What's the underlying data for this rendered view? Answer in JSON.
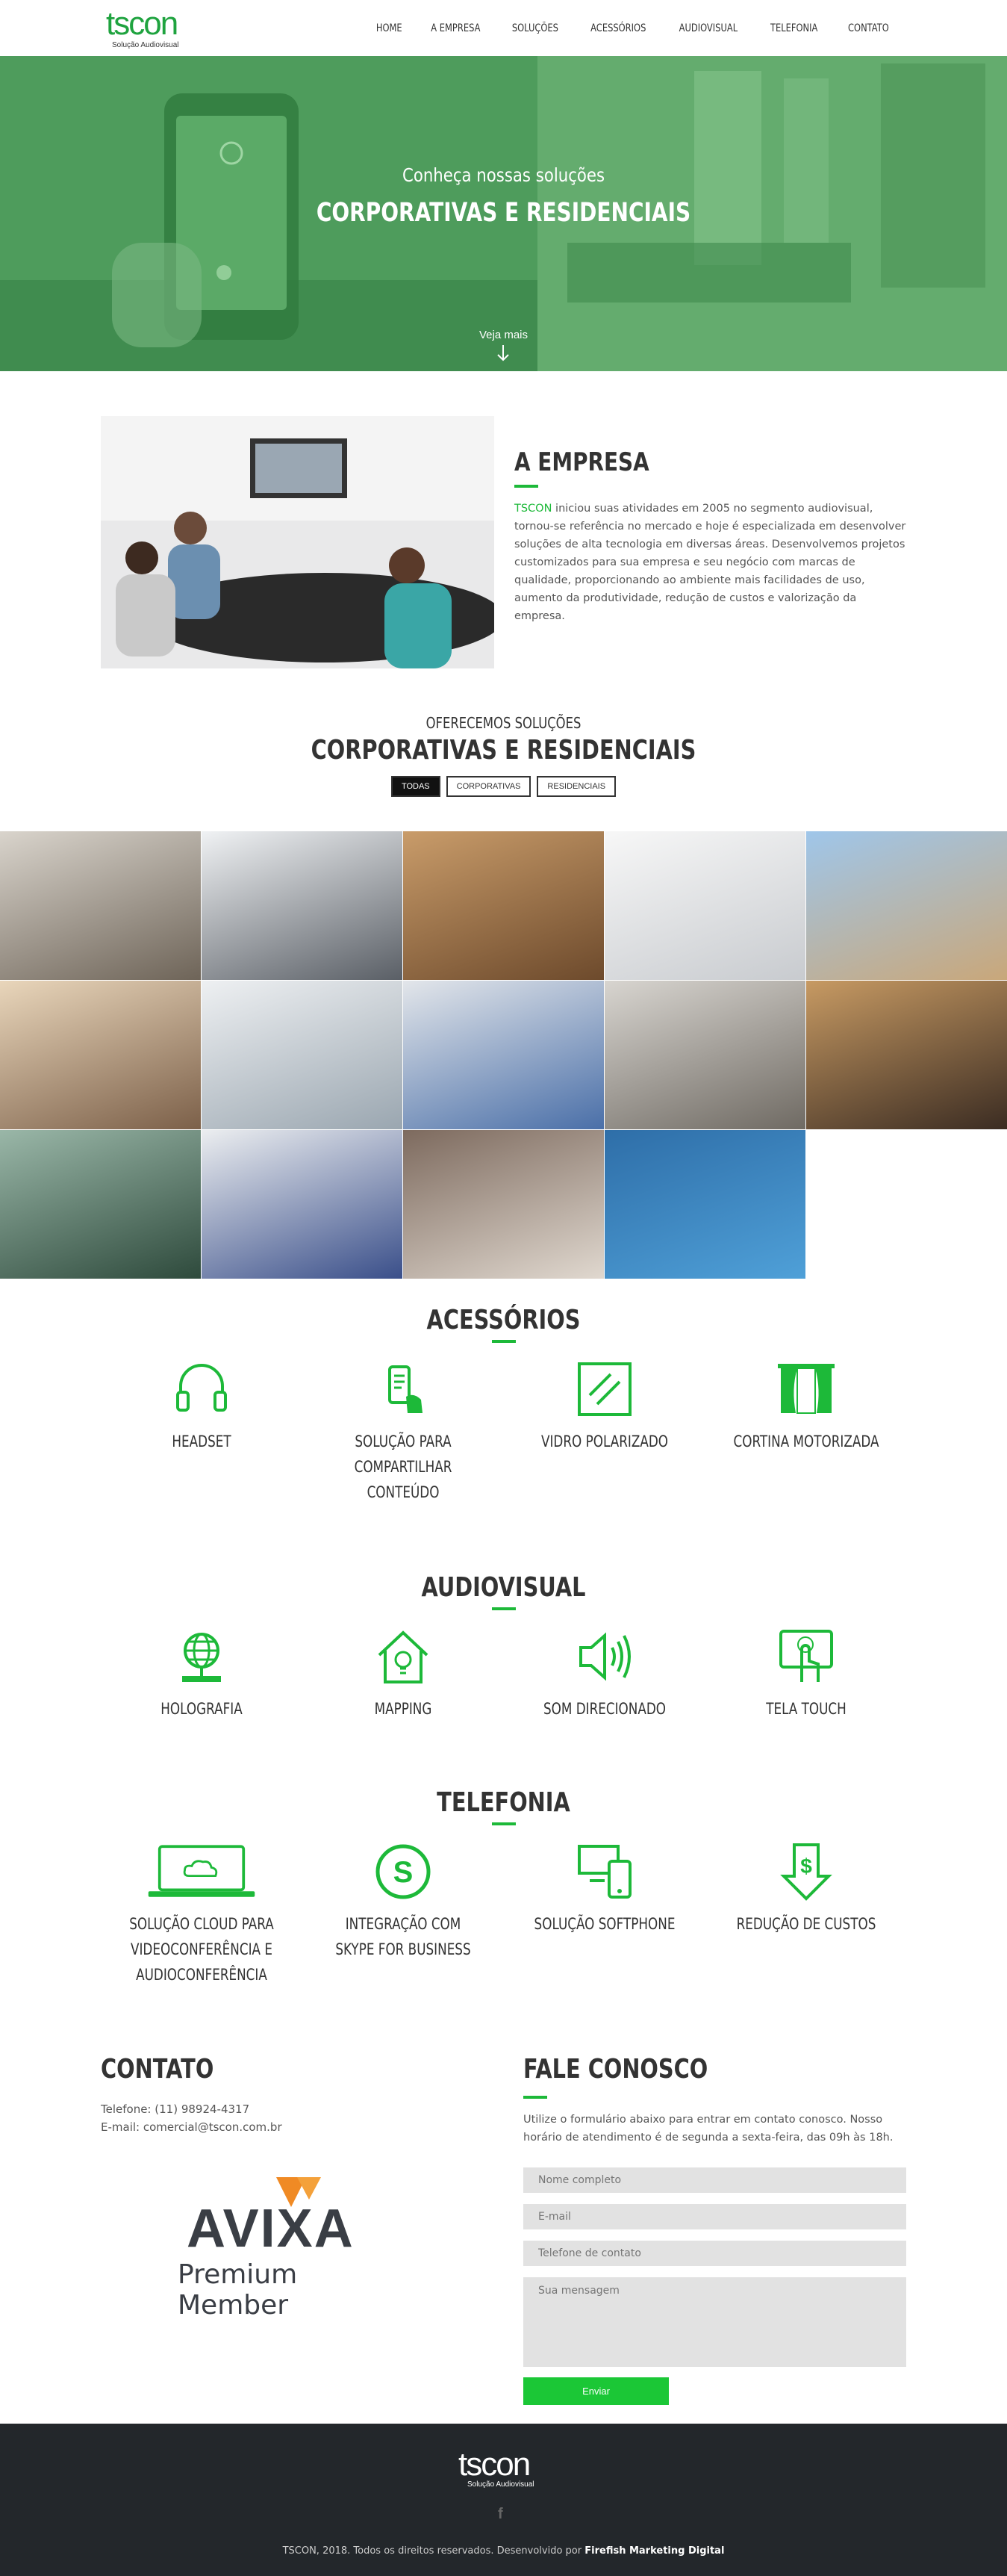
{
  "header": {
    "logo_word": "tscon",
    "logo_sub": "Solução Audiovisual",
    "nav": [
      "HOME",
      "A EMPRESA",
      "SOLUÇÕES",
      "ACESSÓRIOS",
      "AUDIOVISUAL",
      "TELEFONIA",
      "CONTATO"
    ]
  },
  "hero": {
    "subtitle": "Conheça nossas soluções",
    "title": "CORPORATIVAS E RESIDENCIAIS",
    "more": "Veja mais"
  },
  "about": {
    "title": "A EMPRESA",
    "brand": "TSCON",
    "text": " iniciou suas atividades em 2005 no segmento audiovisual, tornou-se referência no mercado e hoje é especializada em desenvolver soluções de alta tecnologia em diversas áreas. Desenvolvemos projetos customizados para sua empresa e seu negócio com marcas de qualidade, proporcionando ao ambiente mais facilidades de uso, aumento da produtividade, redução de custos e valorização da empresa."
  },
  "solutions": {
    "subtitle": "OFERECEMOS SOLUÇÕES",
    "title": "CORPORATIVAS E RESIDENCIAIS",
    "filters": [
      "TODAS",
      "CORPORATIVAS",
      "RESIDENCIAIS"
    ],
    "active_filter": "TODAS"
  },
  "accessories": {
    "title": "ACESSÓRIOS",
    "items": [
      {
        "icon": "headset-icon",
        "label_lines": [
          "HEADSET"
        ]
      },
      {
        "icon": "share-phone-icon",
        "label_lines": [
          "SOLUÇÃO PARA",
          "COMPARTILHAR",
          "CONTEÚDO"
        ]
      },
      {
        "icon": "glass-icon",
        "label_lines": [
          "VIDRO POLARIZADO"
        ]
      },
      {
        "icon": "curtain-icon",
        "label_lines": [
          "CORTINA MOTORIZADA"
        ]
      }
    ]
  },
  "audiovisual": {
    "title": "AUDIOVISUAL",
    "items": [
      {
        "icon": "globe-icon",
        "label_lines": [
          "HOLOGRAFIA"
        ]
      },
      {
        "icon": "house-bulb-icon",
        "label_lines": [
          "MAPPING"
        ]
      },
      {
        "icon": "speaker-icon",
        "label_lines": [
          "SOM DIRECIONADO"
        ]
      },
      {
        "icon": "touch-icon",
        "label_lines": [
          "TELA TOUCH"
        ]
      }
    ]
  },
  "telephony": {
    "title": "TELEFONIA",
    "items": [
      {
        "icon": "laptop-cloud-icon",
        "label_lines": [
          "SOLUÇÃO CLOUD PARA",
          "VIDEOCONFERÊNCIA E",
          "AUDIOCONFERÊNCIA"
        ]
      },
      {
        "icon": "skype-icon",
        "label_lines": [
          "INTEGRAÇÃO COM",
          "SKYPE FOR BUSINESS"
        ]
      },
      {
        "icon": "devices-icon",
        "label_lines": [
          "SOLUÇÃO SOFTPHONE"
        ]
      },
      {
        "icon": "cost-down-icon",
        "label_lines": [
          "REDUÇÃO DE CUSTOS"
        ]
      }
    ]
  },
  "contact": {
    "title": "CONTATO",
    "phone": "Telefone: (11) 98924-4317",
    "email": "E-mail: comercial@tscon.com.br",
    "avixa_word": "AVIXA",
    "avixa_sub": "Premium Member",
    "form_title": "FALE CONOSCO",
    "form_text": "Utilize o formulário abaixo para entrar em contato conosco. Nosso horário de atendimento é de segunda a sexta-feira, das 09h às 18h.",
    "placeholders": {
      "name": "Nome completo",
      "email": "E-mail",
      "phone": "Telefone de contato",
      "message": "Sua mensagem"
    },
    "send": "Enviar"
  },
  "footer": {
    "logo_word": "tscon",
    "logo_sub": "Solução Audiovisual",
    "copy": "TSCON, 2018. Todos os direitos reservados. Desenvolvido por ",
    "dev": "Firefish Marketing Digital"
  },
  "colors": {
    "accent": "#1db939",
    "hero": "#4f9e5d",
    "footer": "#23272b"
  }
}
